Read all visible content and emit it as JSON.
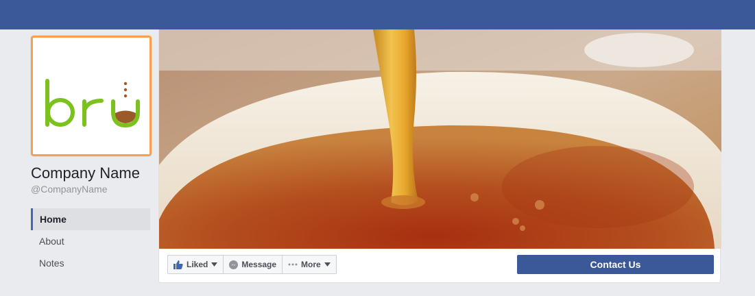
{
  "page": {
    "name": "Company Name",
    "handle": "@CompanyName",
    "logo_text": "bru"
  },
  "nav": {
    "items": [
      {
        "label": "Home",
        "active": true
      },
      {
        "label": "About",
        "active": false
      },
      {
        "label": "Notes",
        "active": false
      }
    ]
  },
  "actions": {
    "liked_label": "Liked",
    "message_label": "Message",
    "more_label": "More",
    "contact_label": "Contact Us"
  },
  "colors": {
    "topbar": "#3b5998",
    "profile_border": "#f5a14d",
    "logo_green": "#7cc21e",
    "logo_brown": "#9a5a2a",
    "contact_button": "#3b5998"
  },
  "icons": {
    "liked": "thumbs-up-icon",
    "message": "messenger-icon",
    "more": "ellipsis-icon",
    "caret": "caret-down-icon"
  }
}
